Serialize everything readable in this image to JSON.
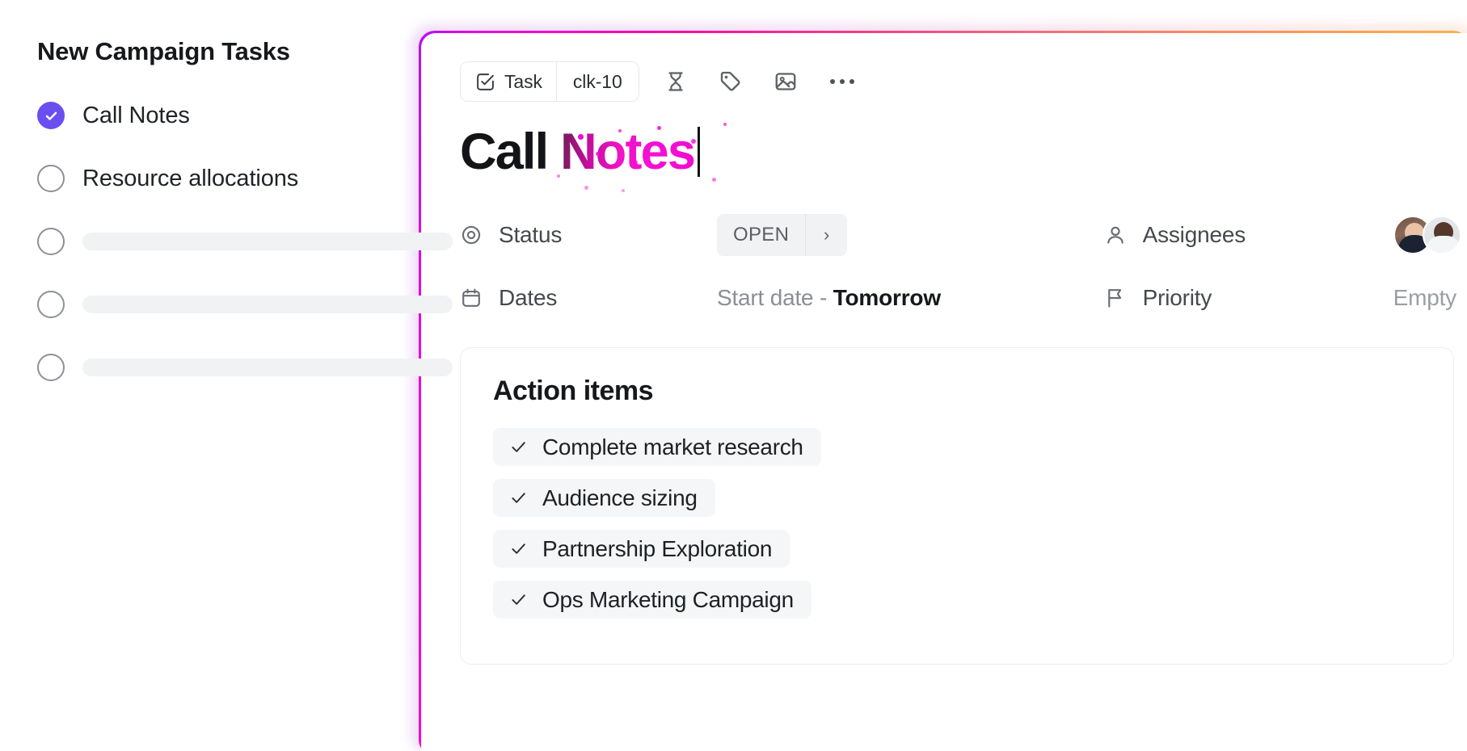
{
  "sidebar": {
    "title": "New Campaign Tasks",
    "items": [
      {
        "label": "Call Notes",
        "checked": true,
        "placeholder": false
      },
      {
        "label": "Resource allocations",
        "checked": false,
        "placeholder": false
      },
      {
        "label": "",
        "checked": false,
        "placeholder": true
      },
      {
        "label": "",
        "checked": false,
        "placeholder": true
      },
      {
        "label": "",
        "checked": false,
        "placeholder": true
      }
    ]
  },
  "card": {
    "toolbar": {
      "type_icon": "task-checkbox-icon",
      "type_label": "Task",
      "task_id": "clk-10",
      "icons": [
        {
          "name": "hourglass-icon"
        },
        {
          "name": "tag-icon"
        },
        {
          "name": "image-icon"
        },
        {
          "name": "more-options-icon"
        }
      ]
    },
    "title": {
      "plain": "Call",
      "accent": "Notes",
      "full": "Call Notes",
      "accent_color": "#f20ad0",
      "plain_color": "#121417"
    },
    "meta": {
      "status": {
        "icon": "target-circle-icon",
        "label": "Status",
        "value": "OPEN",
        "chevron": "›"
      },
      "assignees": {
        "icon": "person-icon",
        "label": "Assignees",
        "count": 2
      },
      "dates": {
        "icon": "calendar-icon",
        "label": "Dates",
        "placeholder": "Start date - ",
        "value": "Tomorrow"
      },
      "priority": {
        "icon": "flag-icon",
        "label": "Priority",
        "value": "Empty"
      }
    },
    "action_items": {
      "heading": "Action items",
      "items": [
        "Complete market research",
        "Audience sizing",
        "Partnership Exploration",
        "Ops Marketing Campaign"
      ]
    },
    "border_gradient": {
      "from": "#b70ef2",
      "mid": "#fb0aa6",
      "to": "#fbbf43"
    }
  }
}
